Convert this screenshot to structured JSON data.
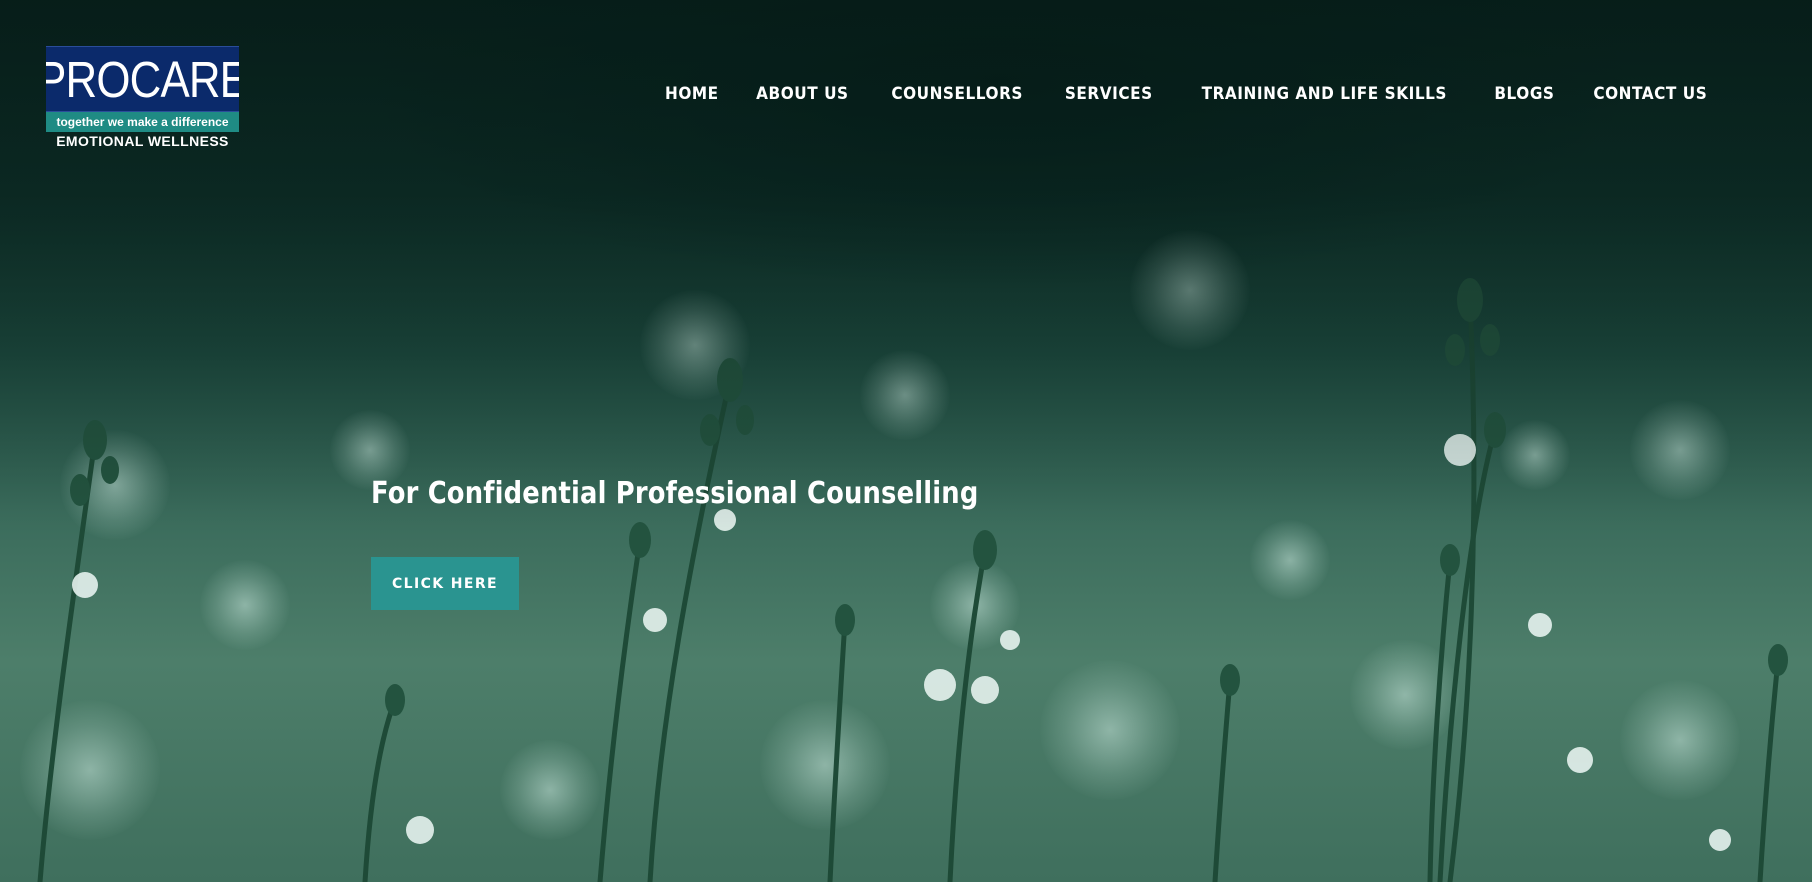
{
  "logo": {
    "name": "PROCARE",
    "tagline": "together we make a difference",
    "subtitle": "EMOTIONAL WELLNESS"
  },
  "nav": {
    "items": [
      {
        "label": "HOME"
      },
      {
        "label": "ABOUT US"
      },
      {
        "label": "COUNSELLORS"
      },
      {
        "label": "SERVICES"
      },
      {
        "label": "TRAINING AND LIFE SKILLS"
      },
      {
        "label": "BLOGS"
      },
      {
        "label": "CONTACT US"
      }
    ]
  },
  "hero": {
    "heading": "For Confidential Professional Counselling",
    "cta_label": "CLICK HERE"
  },
  "colors": {
    "accent": "#2a9490",
    "logo_blue": "#0b2a6b",
    "logo_teal": "#1f8b84",
    "background_dark": "#0a2722",
    "background_green": "#4d7e6a"
  }
}
